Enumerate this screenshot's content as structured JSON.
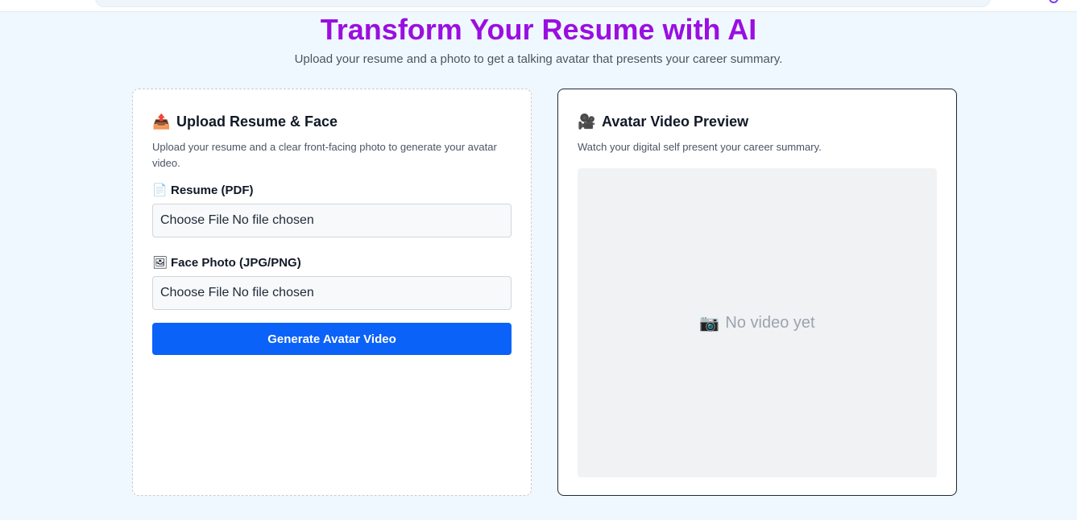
{
  "hero": {
    "title": "Transform Your Resume with AI",
    "subtitle": "Upload your resume and a photo to get a talking avatar that presents your career summary."
  },
  "upload_card": {
    "icon": "outbox-tray-icon",
    "title": "Upload Resume & Face",
    "description": "Upload your resume and a clear front-facing photo to generate your avatar video.",
    "resume_field": {
      "icon": "document-icon",
      "label": "Resume (PDF)",
      "button_label": "Choose File",
      "status": "No file chosen"
    },
    "photo_field": {
      "icon": "framed-picture-icon",
      "label": "Face Photo (JPG/PNG)",
      "button_label": "Choose File",
      "status": "No file chosen"
    },
    "generate_button": "Generate Avatar Video"
  },
  "preview_card": {
    "icon": "film-camera-icon",
    "title": "Avatar Video Preview",
    "description": "Watch your digital self present your career summary.",
    "placeholder_icon": "camera-icon",
    "placeholder_text": "No video yet"
  },
  "colors": {
    "page_background": "#eff8fe",
    "title": "#9a0fe0",
    "primary_button": "#0b62f8",
    "placeholder_text": "#9ca3af"
  }
}
